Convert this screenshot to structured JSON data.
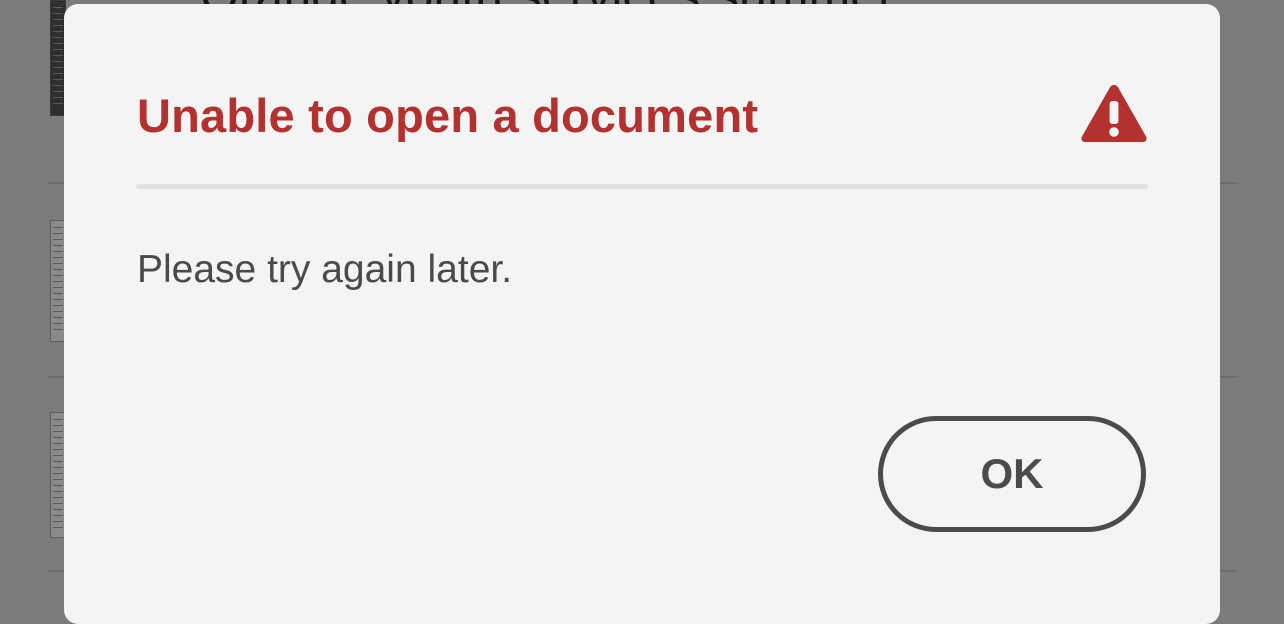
{
  "background": {
    "heading_fragment": "Orange youth services summer"
  },
  "dialog": {
    "title": "Unable to open a document",
    "icon": "warning-triangle-icon",
    "message": "Please try again later.",
    "ok_label": "OK"
  },
  "colors": {
    "title": "#b3312f",
    "icon": "#b3312f",
    "dialog_background": "#f4f4f4",
    "overlay": "#7b7b7b",
    "button_border": "#4b4b4b"
  }
}
